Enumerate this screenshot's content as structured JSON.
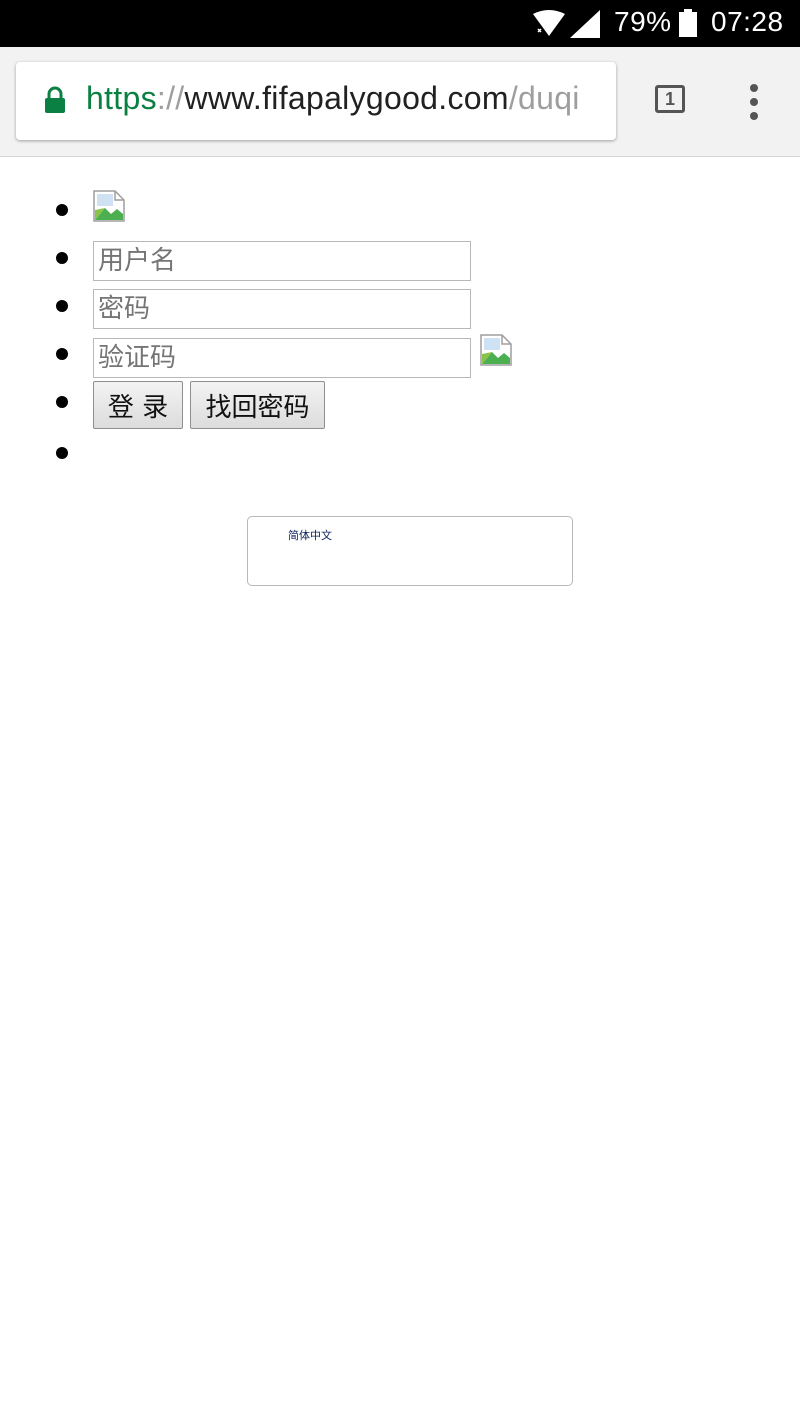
{
  "status_bar": {
    "battery_percent": "79%",
    "time": "07:28",
    "wifi_icon": "wifi-icon",
    "signal_icon": "cell-signal-icon",
    "battery_icon": "battery-icon"
  },
  "browser": {
    "url_scheme": "https",
    "url_separator": "://",
    "url_host": "www.fifapalygood.com",
    "url_path": "/duqi",
    "tab_count": "1",
    "lock_icon": "lock-icon",
    "menu_icon": "overflow-menu-icon",
    "scheme_color": "#0b8043"
  },
  "form": {
    "logo_icon": "broken-image-icon",
    "username_placeholder": "用户名",
    "password_placeholder": "密码",
    "captcha_placeholder": "验证码",
    "captcha_icon": "broken-image-icon",
    "login_label": "登 录",
    "recover_label": "找回密码"
  },
  "language": {
    "selected": "简体中文"
  }
}
